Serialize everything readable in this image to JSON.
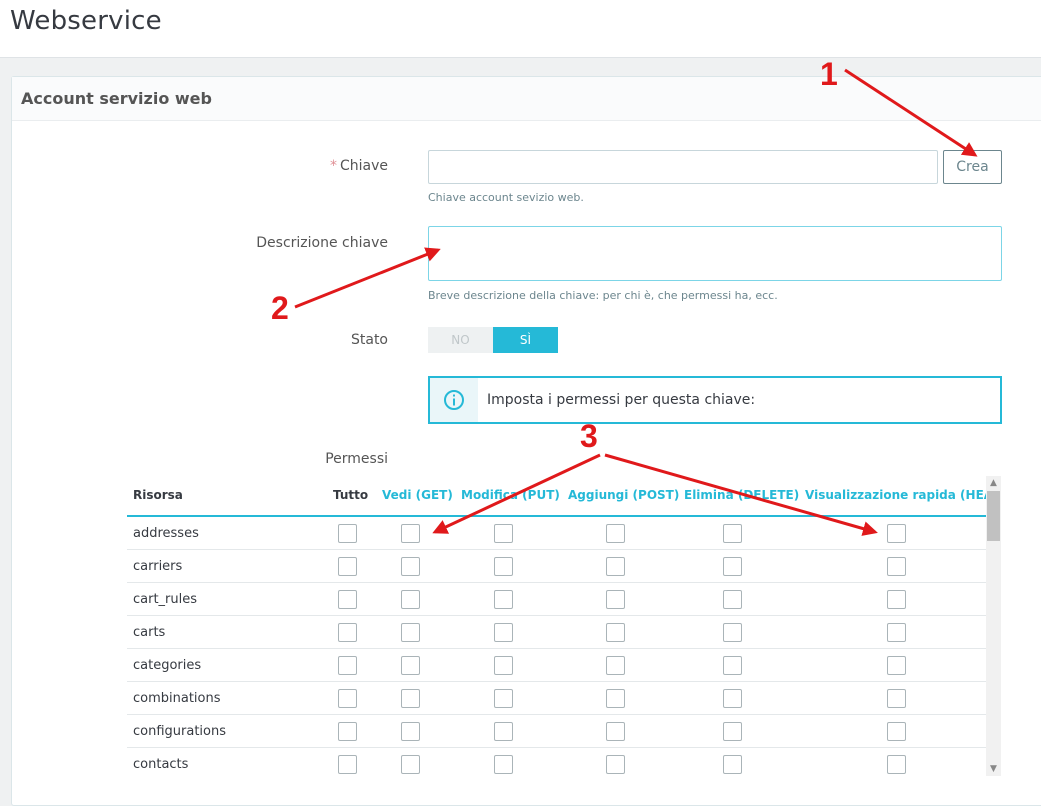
{
  "page": {
    "title": "Webservice"
  },
  "panel": {
    "heading": "Account servizio web"
  },
  "form": {
    "chiave": {
      "required_mark": "*",
      "label": "Chiave",
      "value": "",
      "help": "Chiave account sevizio web.",
      "generate_button": "Crea"
    },
    "descrizione": {
      "label": "Descrizione chiave",
      "value": "",
      "help": "Breve descrizione della chiave: per chi è, che permessi ha, ecc."
    },
    "stato": {
      "label": "Stato",
      "option_no": "NO",
      "option_si": "SÌ",
      "selected": "SÌ"
    },
    "info_alert": {
      "icon": "info-circle-icon",
      "text": "Imposta i permessi per questa chiave:"
    },
    "permessi": {
      "label": "Permessi",
      "columns": [
        "Risorsa",
        "Tutto",
        "Vedi (GET)",
        "Modifica (PUT)",
        "Aggiungi (POST)",
        "Elimina (DELETE)",
        "Visualizzazione rapida (HEAD)"
      ],
      "rows": [
        "addresses",
        "carriers",
        "cart_rules",
        "carts",
        "categories",
        "combinations",
        "configurations",
        "contacts"
      ]
    }
  },
  "annotations": [
    "1",
    "2",
    "3"
  ],
  "colors": {
    "accent": "#25b9d7",
    "annotation_red": "#e0191b"
  }
}
